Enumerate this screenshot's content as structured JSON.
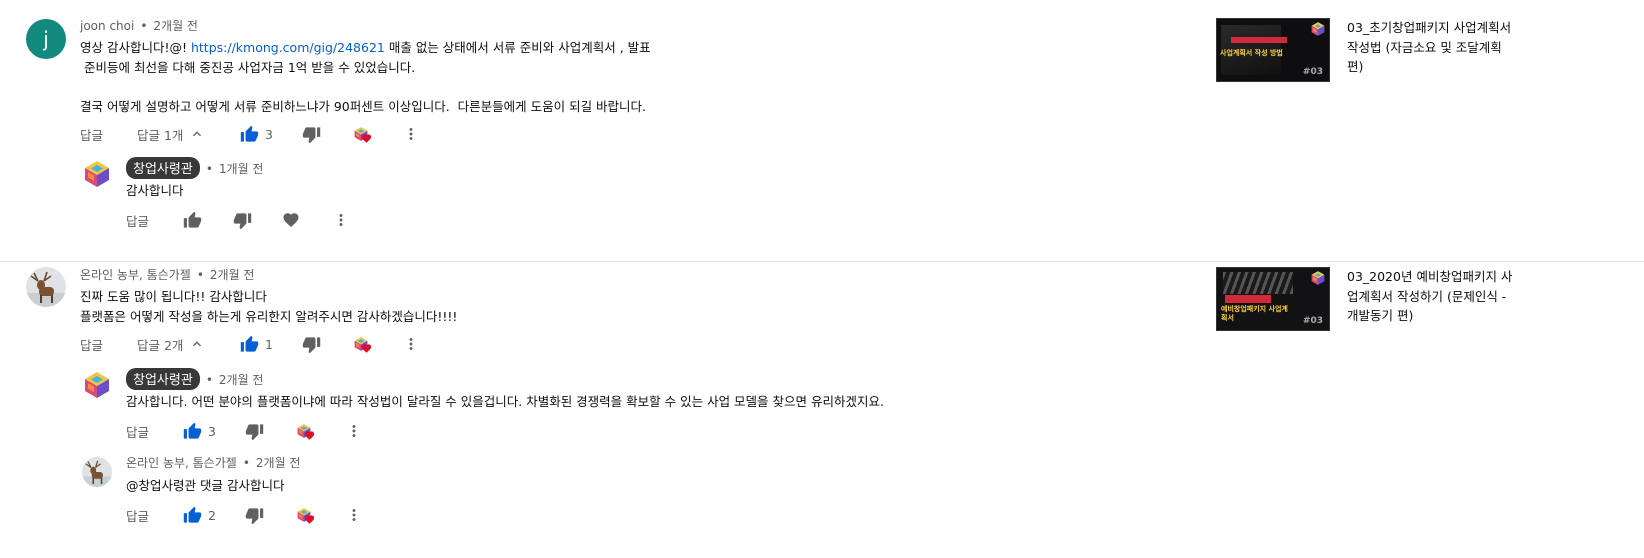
{
  "threads": [
    {
      "author": "joon choi",
      "avatar_letter": "j",
      "time": "2개월 전",
      "text": {
        "line1_prefix": "영상 감사합니다!@! ",
        "link": "https://kmong.com/gig/248621",
        "line1_suffix": " 매출 없는 상태에서 서류 준비와 사업계획서 , 발표",
        "line2": " 준비등에 최선을 다해 중진공 사업자금 1억 받을 수 있었습니다.",
        "line3": "결국 어떻게 설명하고 어떻게 서류 준비하느냐가 90퍼센트 이상입니다.  다른분들에게 도움이 되길 바랍니다."
      },
      "reply_label": "답글",
      "replies_toggle": "답글 1개",
      "likes": "3",
      "related_video": {
        "title": "03_초기창업패키지 사업계획서 작성법 (자금소요 및 조달계획 편)",
        "thumb_tag": "#03",
        "thumb_text": "사업계획서 작성 방법"
      },
      "replies": [
        {
          "author": "창업사령관",
          "is_channel_owner": true,
          "time": "1개월 전",
          "text": "감사합니다",
          "reply_label": "답글",
          "likes": ""
        }
      ]
    },
    {
      "author": "온라인 농부, 톰슨가젤",
      "time": "2개월 전",
      "text": {
        "line1": "진짜 도움 많이 됩니다!! 감사합니다",
        "line2": "플랫폼은 어떻게 작성을 하는게 유리한지 알려주시면 감사하겠습니다!!!!"
      },
      "reply_label": "답글",
      "replies_toggle": "답글 2개",
      "likes": "1",
      "related_video": {
        "title": "03_2020년 예비창업패키지 사업계획서 작성하기 (문제인식 - 개발동기 편)",
        "thumb_tag": "#03",
        "thumb_text": "예비창업패키지 사업계획서"
      },
      "replies": [
        {
          "author": "창업사령관",
          "is_channel_owner": true,
          "time": "2개월 전",
          "text": "감사합니다. 어떤 분야의 플랫폼이냐에 따라 작성법이 달라질 수 있을겁니다. 차별화된 경쟁력을 확보할 수 있는 사업 모델을 찾으면 유리하겠지요.",
          "reply_label": "답글",
          "likes": "3"
        },
        {
          "author": "온라인 농부, 톰슨가젤",
          "time": "2개월 전",
          "text": "@창업사령관 댓글 감사합니다",
          "reply_label": "답글",
          "likes": "2"
        }
      ]
    }
  ],
  "icons": {
    "like": "thumb-up-icon",
    "dislike": "thumb-down-icon",
    "creator_heart": "creator-heart-icon",
    "heart": "heart-icon",
    "more": "more-vert-icon",
    "chevron": "chevron-up-icon"
  },
  "colors": {
    "like_active": "#065fd4",
    "link": "#065fd4",
    "heart": "#e00d2a",
    "avatar_j": "#128a7d",
    "badge_bg": "#383838"
  },
  "sep": "•"
}
